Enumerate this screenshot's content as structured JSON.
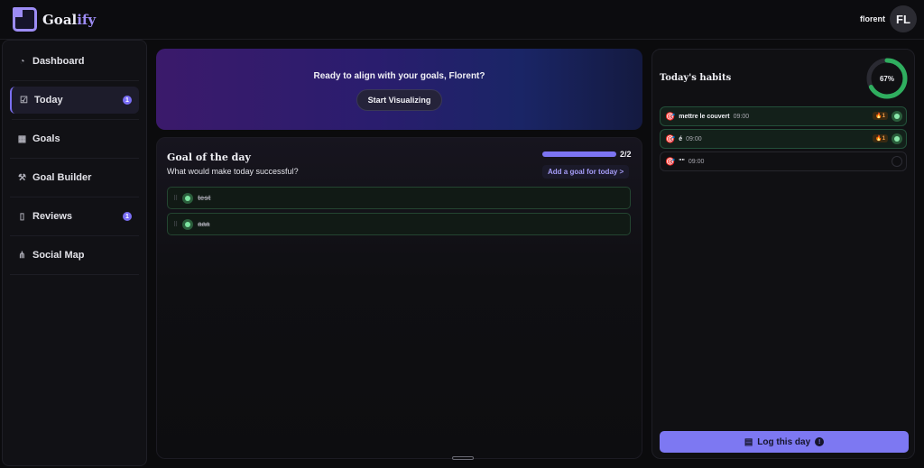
{
  "app": {
    "logo_main": "Goal",
    "logo_accent": "ify"
  },
  "user": {
    "name": "florent",
    "initials": "FL"
  },
  "sidebar": {
    "items": [
      {
        "label": "Dashboard",
        "icon": "gauge-icon",
        "badge": "",
        "active": false
      },
      {
        "label": "Today",
        "icon": "checkbox-icon",
        "badge": "1",
        "active": true
      },
      {
        "label": "Goals",
        "icon": "film-icon",
        "badge": "",
        "active": false
      },
      {
        "label": "Goal Builder",
        "icon": "hammer-icon",
        "badge": "",
        "active": false
      },
      {
        "label": "Reviews",
        "icon": "document-icon",
        "badge": "1",
        "active": false
      },
      {
        "label": "Social Map",
        "icon": "network-icon",
        "badge": "",
        "active": false
      }
    ]
  },
  "hero": {
    "title": "Ready to align with your goals, Florent?",
    "button_label": "Start Visualizing"
  },
  "goal_of_day": {
    "title": "Goal of the day",
    "subtitle": "What would make today successful?",
    "progress_text": "2/2",
    "progress_fraction": 1.0,
    "add_label": "Add a goal for today >",
    "items": [
      {
        "text": "test",
        "done": true
      },
      {
        "text": "aaa",
        "done": true
      }
    ]
  },
  "habits": {
    "title": "Today's habits",
    "percent_label": "67%",
    "percent": 0.67,
    "items": [
      {
        "emoji": "🎯",
        "name": "mettre le couvert",
        "time": "09:00",
        "streak": "🔥1",
        "done": true
      },
      {
        "emoji": "🎯",
        "name": "é",
        "time": "09:00",
        "streak": "🔥1",
        "done": true
      },
      {
        "emoji": "🎯",
        "name": "\"\"",
        "time": "09:00",
        "streak": "",
        "done": false
      }
    ],
    "log_label": "Log this day",
    "log_info": "!"
  },
  "colors": {
    "accent": "#7d78f2",
    "success": "#2fae5f",
    "ring_track": "#2a2a32"
  }
}
